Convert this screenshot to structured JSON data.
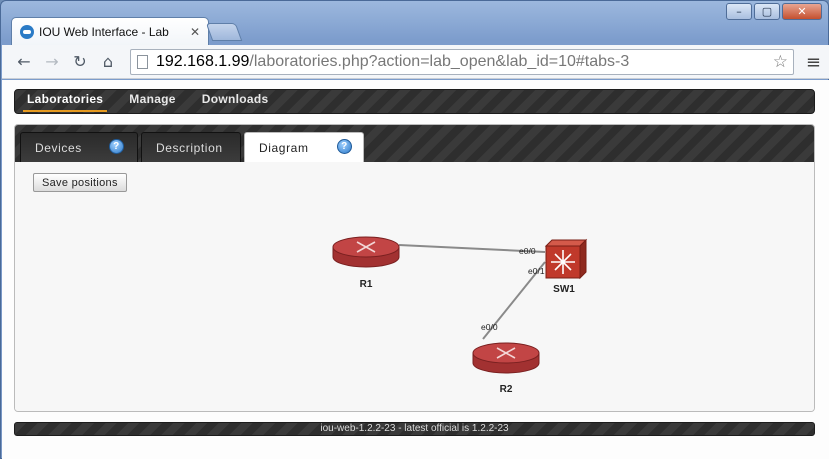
{
  "browser": {
    "tab_title": "IOU Web Interface - Lab",
    "url_host": "192.168.1.99",
    "url_rest": "/laboratories.php?action=lab_open&lab_id=10#tabs-3"
  },
  "nav": {
    "items": [
      {
        "label": "Laboratories",
        "active": true
      },
      {
        "label": "Manage",
        "active": false
      },
      {
        "label": "Downloads",
        "active": false
      }
    ]
  },
  "tabs": [
    {
      "label": "Devices",
      "help": true,
      "active": false
    },
    {
      "label": "Description",
      "help": false,
      "active": false
    },
    {
      "label": "Diagram",
      "help": true,
      "active": true
    }
  ],
  "diagram": {
    "save_label": "Save positions",
    "devices": [
      {
        "name": "R1",
        "type": "router"
      },
      {
        "name": "SW1",
        "type": "layer3-switch"
      },
      {
        "name": "R2",
        "type": "router"
      }
    ],
    "links": [
      {
        "from": "R1",
        "to": "SW1",
        "from_port": "",
        "to_port": "e0/0"
      },
      {
        "from": "R2",
        "to": "SW1",
        "from_port": "e0/0",
        "to_port": "e0/1"
      }
    ]
  },
  "footer": {
    "text": "iou-web-1.2.2-23 - latest official is 1.2.2-23"
  },
  "colors": {
    "accent": "#e69a1f",
    "router": "#b83a3a",
    "switch": "#c0392b"
  }
}
